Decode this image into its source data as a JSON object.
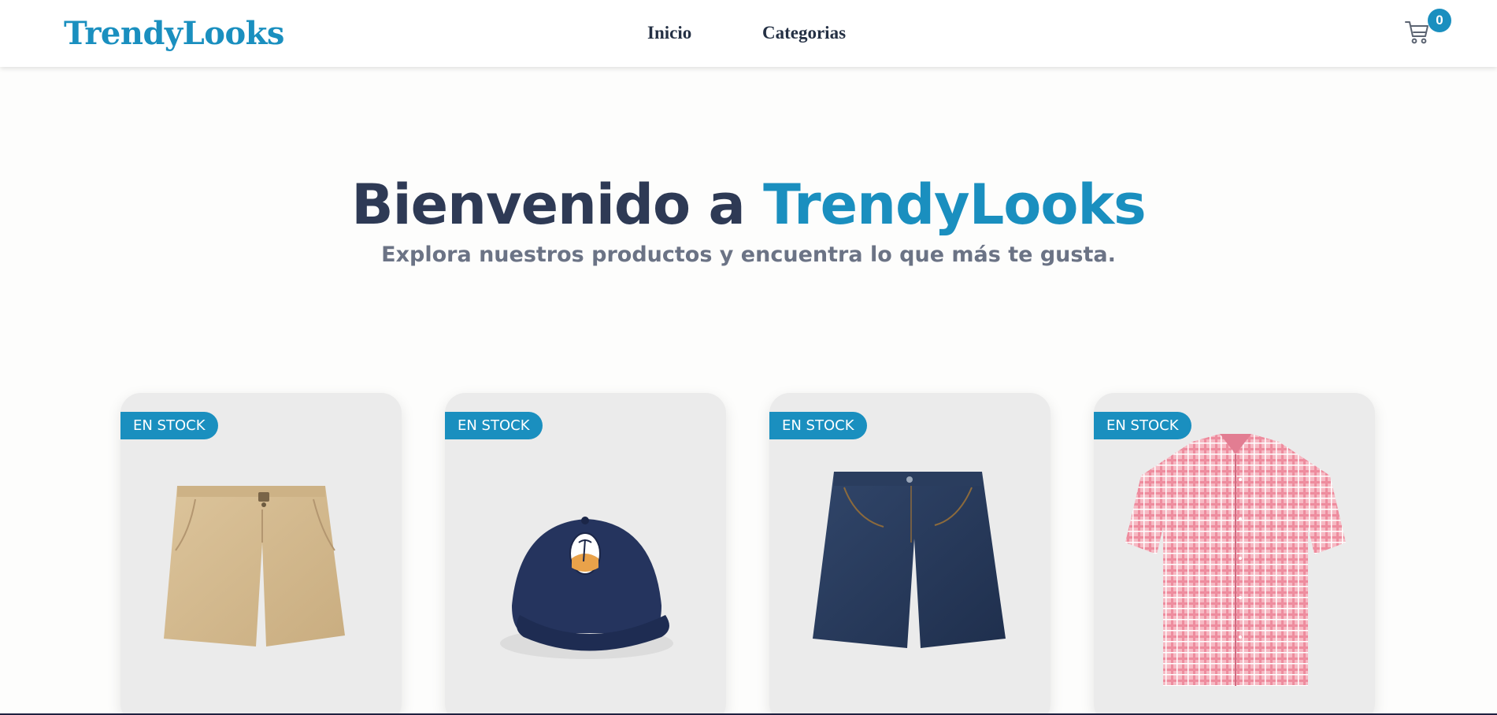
{
  "navbar": {
    "logo": "TrendyLooks",
    "links": [
      "Inicio",
      "Categorias"
    ],
    "cart_count": "0",
    "cart_icon": "shopping-cart-icon"
  },
  "hero": {
    "title_prefix": "Bienvenido a ",
    "title_brand": "TrendyLooks",
    "subtitle": "Explora nuestros productos y encuentra lo que más te gusta."
  },
  "products": [
    {
      "badge": "EN STOCK",
      "image": "khaki-shorts"
    },
    {
      "badge": "EN STOCK",
      "image": "navy-cap"
    },
    {
      "badge": "EN STOCK",
      "image": "denim-shorts"
    },
    {
      "badge": "EN STOCK",
      "image": "pink-plaid-shirt"
    }
  ],
  "colors": {
    "accent": "#1a8fbf",
    "heading": "#2e3a55",
    "subtitle": "#6b7385",
    "card_bg": "#ebebeb"
  }
}
